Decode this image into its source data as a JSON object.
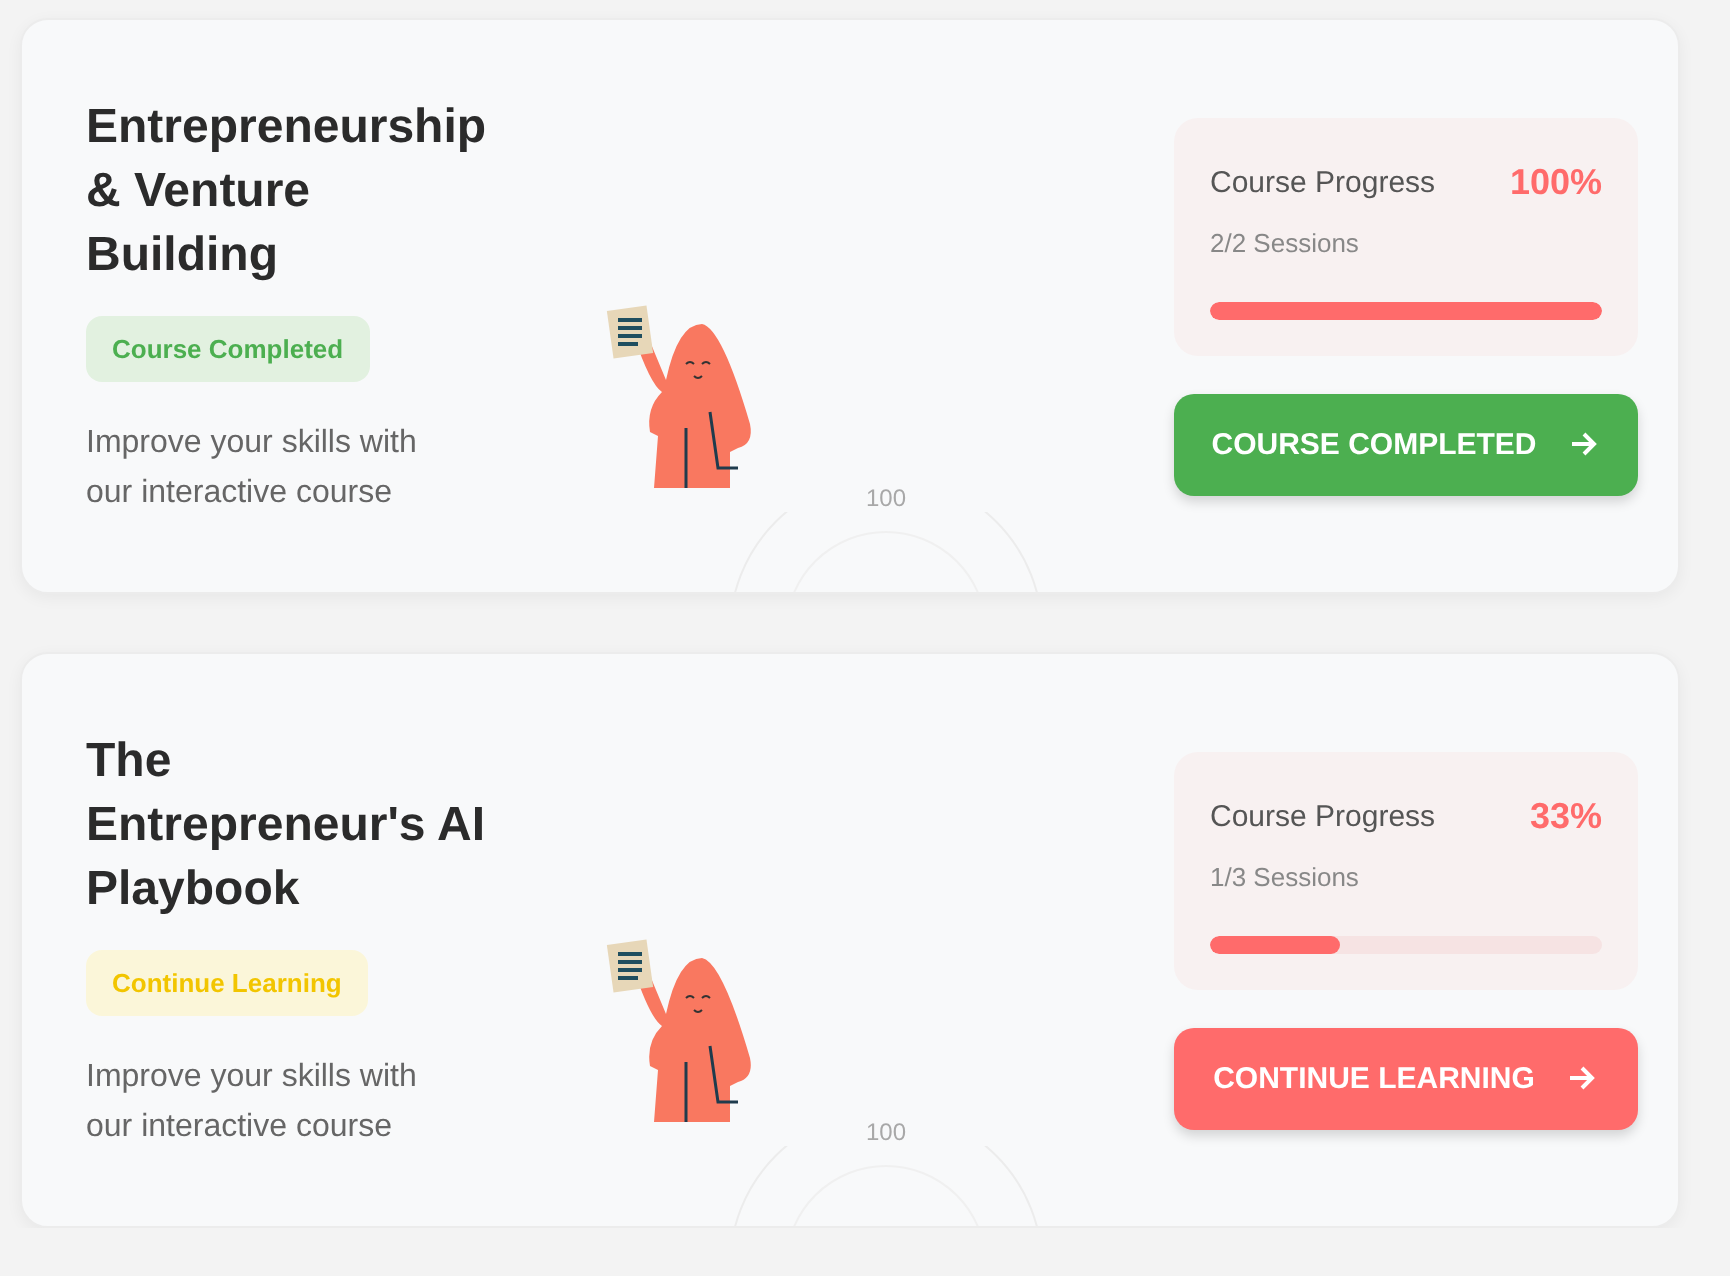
{
  "courses": [
    {
      "title": "Entrepreneurship & Venture Building",
      "status": {
        "kind": "completed",
        "label": "Course Completed"
      },
      "description": "Improve your skills with our interactive course",
      "gauge_label": "100",
      "progress": {
        "label": "Course Progress",
        "percent": "100%",
        "sessions": "2/2 Sessions",
        "level": 1
      },
      "button": {
        "kind": "completed",
        "label": "COURSE COMPLETED"
      }
    },
    {
      "title": "The Entrepreneur's AI Playbook",
      "status": {
        "kind": "learning",
        "label": "Continue Learning"
      },
      "description": "Improve your skills with our interactive course",
      "gauge_label": "100",
      "progress": {
        "label": "Course Progress",
        "percent": "33%",
        "sessions": "1/3 Sessions",
        "level": 0.33
      },
      "button": {
        "kind": "learning",
        "label": "CONTINUE LEARNING"
      }
    }
  ]
}
